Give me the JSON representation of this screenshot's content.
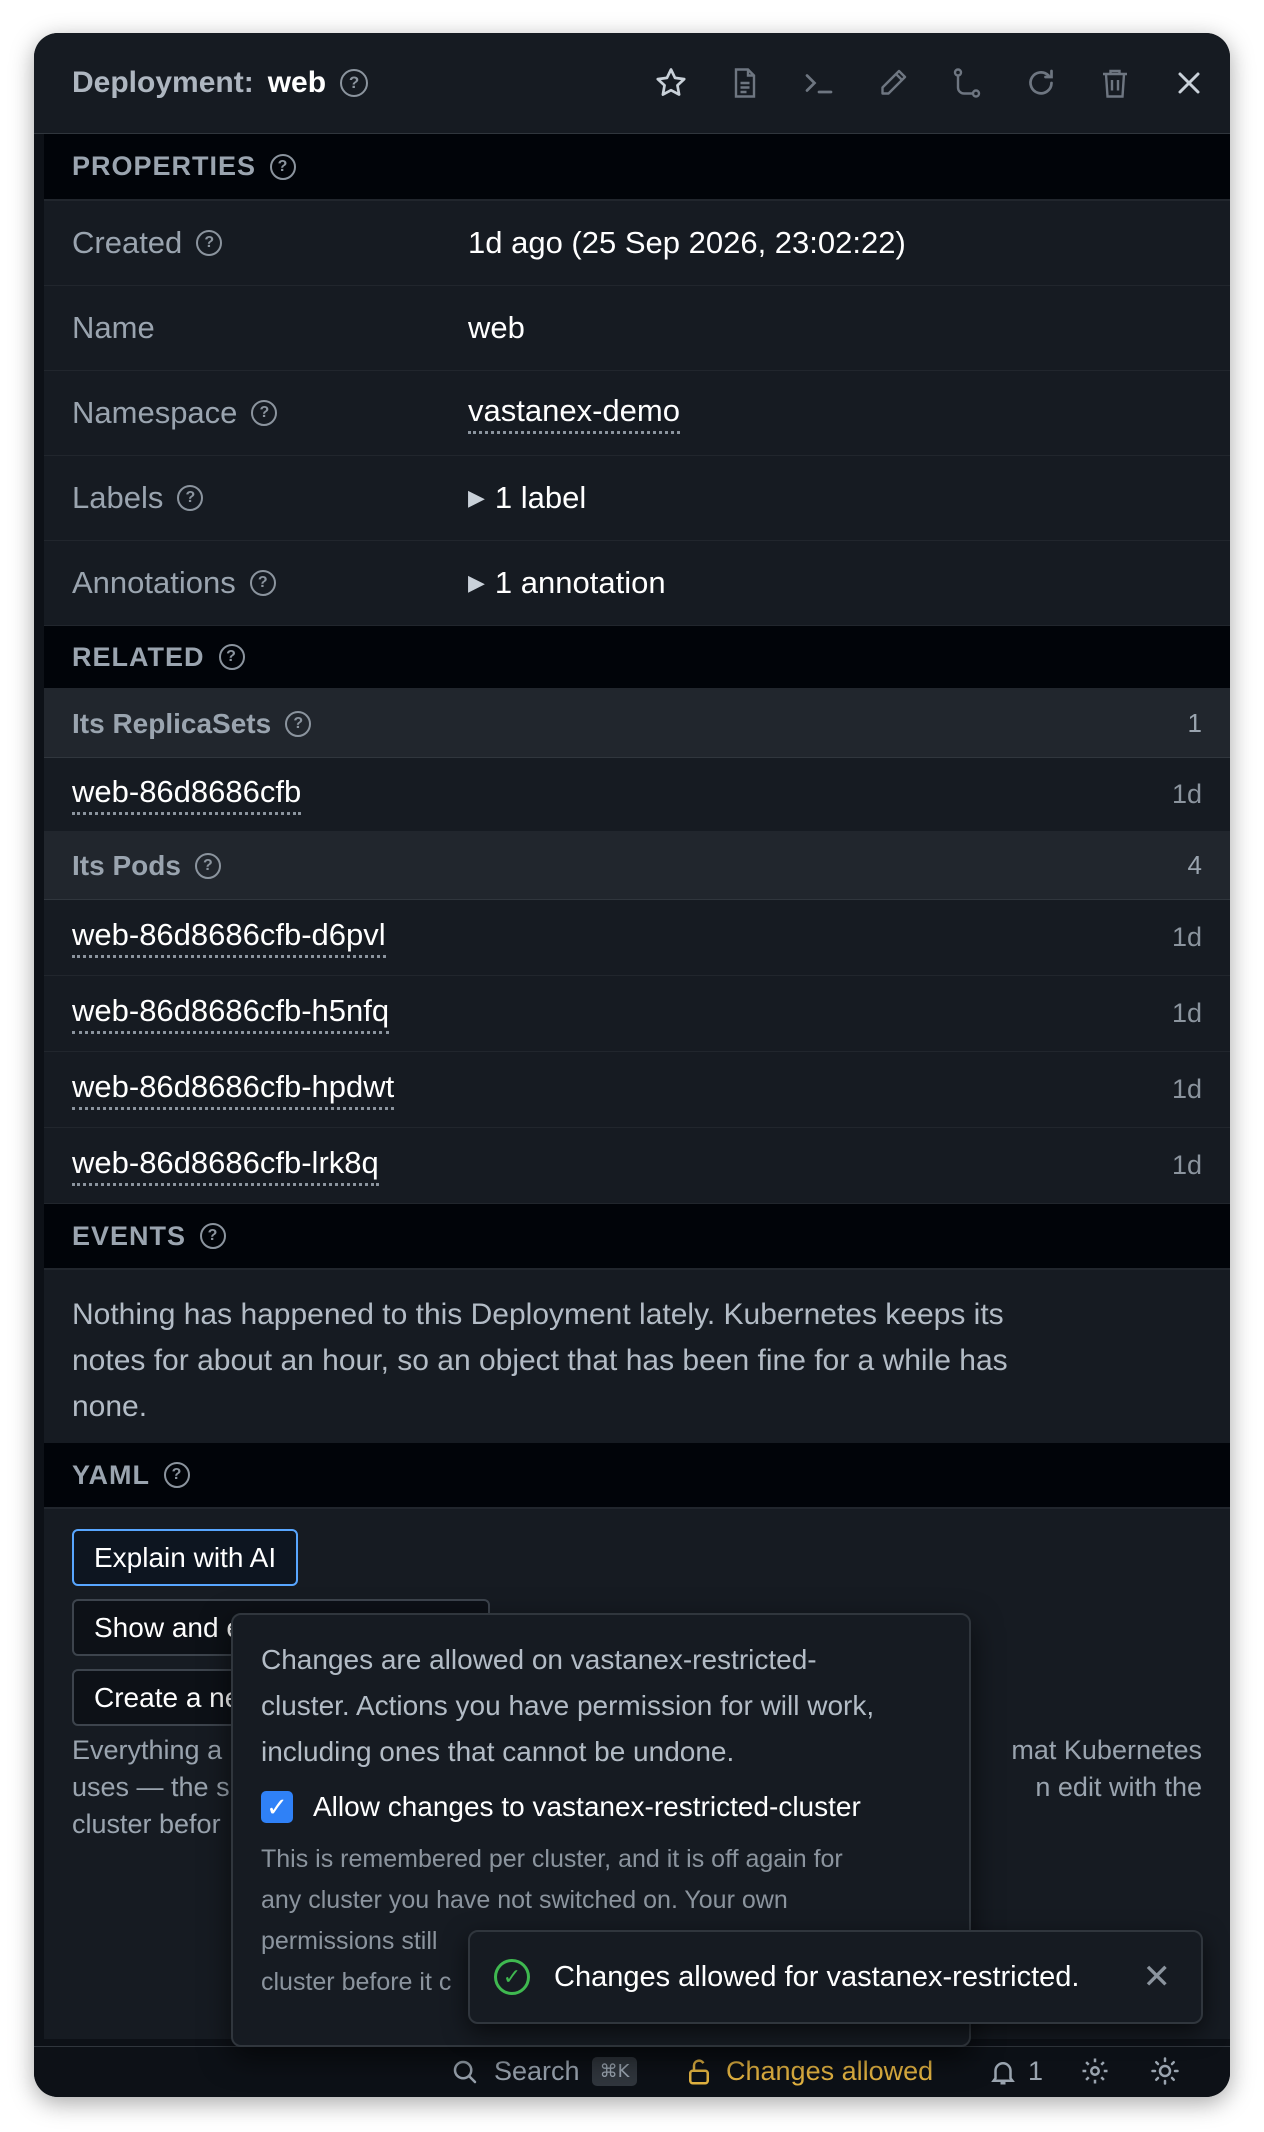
{
  "header": {
    "kind": "Deployment:",
    "name": "web",
    "tools": [
      "star-icon",
      "document-icon",
      "terminal-icon",
      "pencil-icon",
      "branch-icon",
      "refresh-icon",
      "trash-icon",
      "close-icon"
    ]
  },
  "properties": {
    "title": "PROPERTIES",
    "rows": [
      {
        "key": "Created",
        "value": "1d ago (25 Sep 2026, 23:02:22)"
      },
      {
        "key": "Name",
        "value": "web"
      },
      {
        "key": "Namespace",
        "value": "vastanex-demo"
      },
      {
        "key": "Labels",
        "value": "1 label"
      },
      {
        "key": "Annotations",
        "value": "1 annotation"
      }
    ]
  },
  "related": {
    "title": "RELATED",
    "replicasets": {
      "title": "Its ReplicaSets",
      "count": "1",
      "items": [
        {
          "name": "web-86d8686cfb",
          "age": "1d"
        }
      ]
    },
    "pods": {
      "title": "Its Pods",
      "count": "4",
      "items": [
        {
          "name": "web-86d8686cfb-d6pvl",
          "age": "1d"
        },
        {
          "name": "web-86d8686cfb-h5nfq",
          "age": "1d"
        },
        {
          "name": "web-86d8686cfb-hpdwt",
          "age": "1d"
        },
        {
          "name": "web-86d8686cfb-lrk8q",
          "age": "1d"
        }
      ]
    }
  },
  "events": {
    "title": "EVENTS",
    "line1": "Nothing has happened to this Deployment lately. Kubernetes keeps its",
    "line2": "notes for about an hour, so an object that has been fine for a while has",
    "line3": "none."
  },
  "yaml": {
    "title": "YAML",
    "explain_button": "Explain with AI",
    "show_button": "Show and e",
    "create_button": "Create a ne",
    "text_left1": "Everything a",
    "text_right1": "mat Kubernetes",
    "text_left2": "uses — the s",
    "text_right2": "n edit with the",
    "text_left3": "cluster befor"
  },
  "popover": {
    "line1": "Changes are allowed on vastanex-restricted-",
    "line2": "cluster. Actions you have permission for will work,",
    "line3": "including ones that cannot be undone.",
    "checkbox_label": "Allow changes to vastanex-restricted-cluster",
    "checked": true,
    "note1": "This is remembered per cluster, and it is off again for",
    "note2": "any cluster you have not switched on. Your own",
    "note3": "permissions still",
    "note4": "cluster before it c"
  },
  "toast": {
    "message": "Changes allowed for vastanex-restricted."
  },
  "statusbar": {
    "search_label": "Search",
    "search_shortcut": "⌘K",
    "changes_label": "Changes allowed",
    "notifications_count": "1"
  },
  "colors": {
    "accent": "#2f81f7",
    "warning": "#e3b341",
    "success": "#3fb950",
    "background": "#0d1117"
  }
}
